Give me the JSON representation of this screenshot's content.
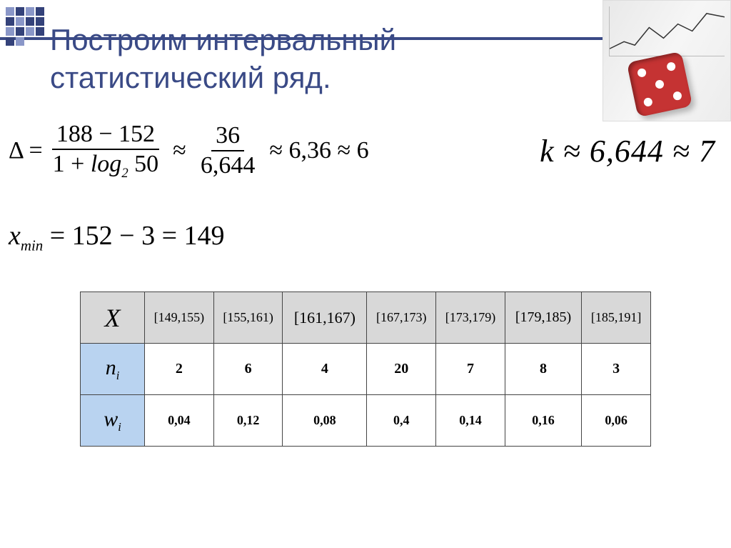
{
  "title": "Построим интервальный статистический ряд.",
  "delta": {
    "lhs": "Δ =",
    "frac1_num": "188 − 152",
    "frac1_den_pre": "1 + ",
    "frac1_den_log": "log",
    "frac1_den_logbase": "2",
    "frac1_den_logarg": " 50",
    "approx1": "≈",
    "frac2_num": "36",
    "frac2_den": "6,644",
    "approx2": "≈ 6,36 ≈ 6"
  },
  "k_eq": "k ≈ 6,644 ≈ 7",
  "xmin": {
    "var": "x",
    "sub": "min",
    "rhs": " = 152 − 3 = 149"
  },
  "table": {
    "row_header_X": "X",
    "row_header_n": "n",
    "row_header_n_sub": "i",
    "row_header_w": "w",
    "row_header_w_sub": "i",
    "intervals": [
      "[149,155)",
      "[155,161)",
      "[161,167)",
      "[167,173)",
      "[173,179)",
      "[179,185)",
      "[185,191]"
    ],
    "n": [
      "2",
      "6",
      "4",
      "20",
      "7",
      "8",
      "3"
    ],
    "w": [
      "0,04",
      "0,12",
      "0,08",
      "0,4",
      "0,14",
      "0,16",
      "0,06"
    ]
  },
  "chart_data": {
    "type": "table",
    "title": "Интервальный статистический ряд",
    "categories": [
      "[149,155)",
      "[155,161)",
      "[161,167)",
      "[167,173)",
      "[173,179)",
      "[179,185)",
      "[185,191]"
    ],
    "series": [
      {
        "name": "n_i",
        "values": [
          2,
          6,
          4,
          20,
          7,
          8,
          3
        ]
      },
      {
        "name": "w_i",
        "values": [
          0.04,
          0.12,
          0.08,
          0.4,
          0.14,
          0.16,
          0.06
        ]
      }
    ],
    "derived": {
      "delta": 6,
      "delta_exact": 6.36,
      "k": 7,
      "k_exact": 6.644,
      "x_min": 149,
      "max": 188,
      "min": 152,
      "N": 50
    }
  }
}
